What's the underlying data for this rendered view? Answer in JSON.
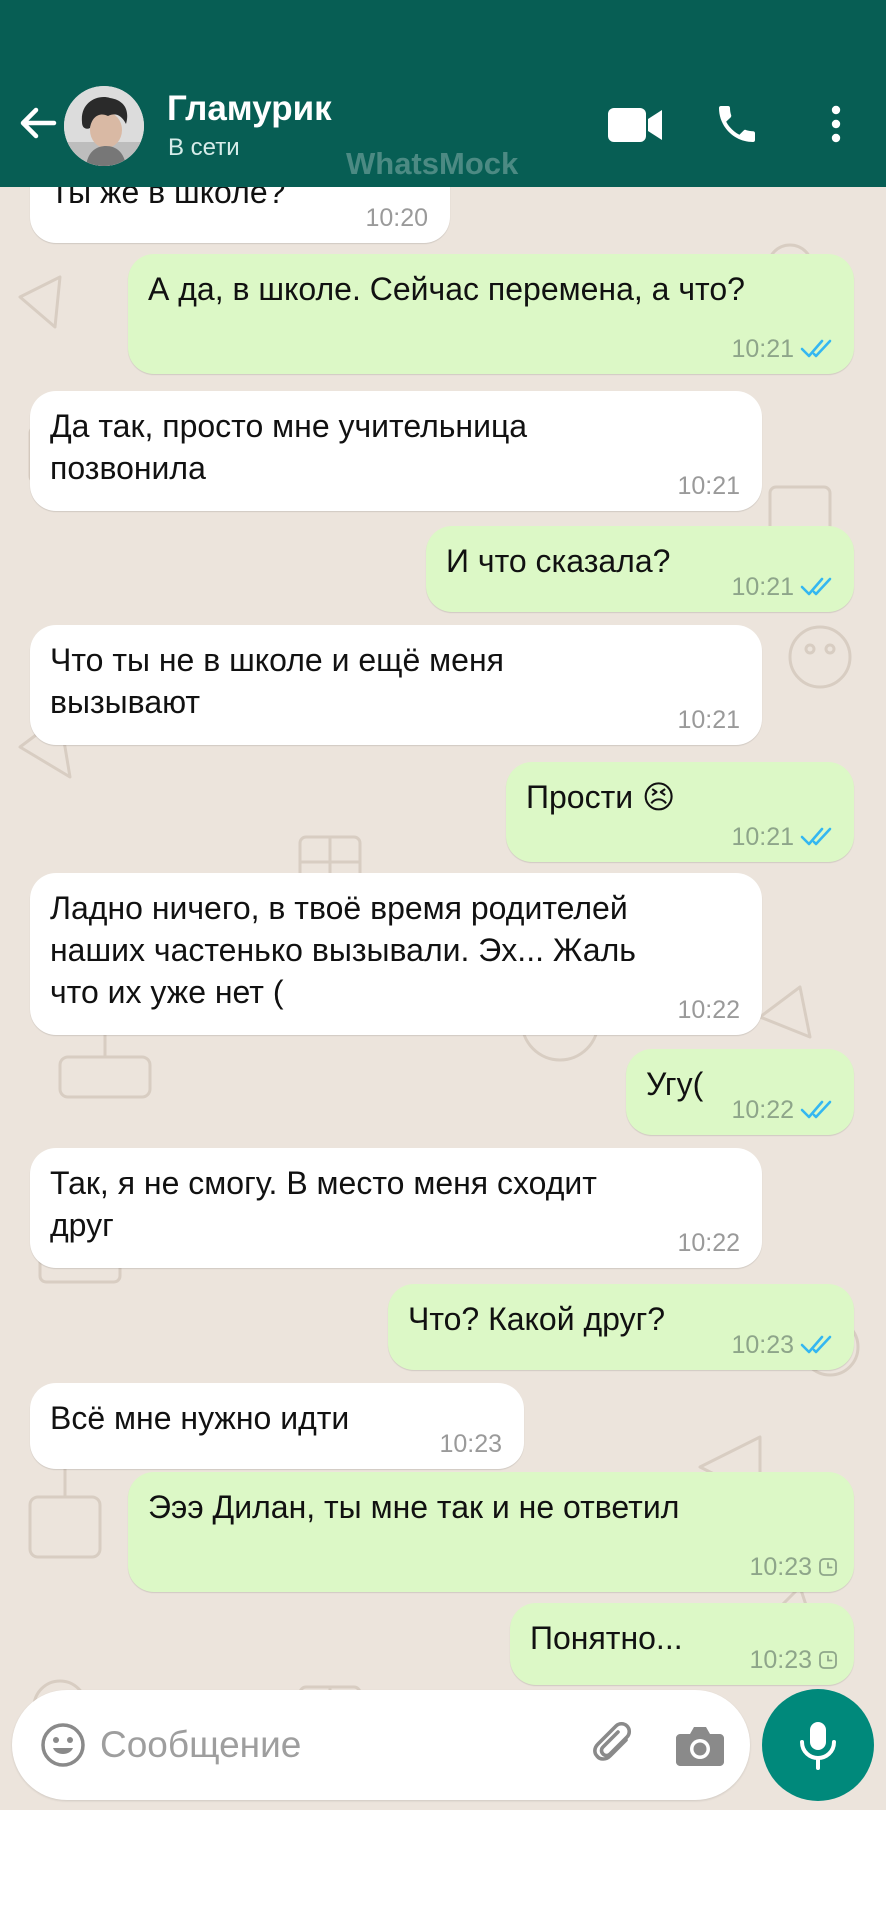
{
  "header": {
    "contact_name": "Гламурик",
    "status": "В сети",
    "watermark": "WhatsMock",
    "icons": [
      "arrow-left-icon",
      "avatar",
      "video-camera-icon",
      "phone-icon",
      "more-vertical-icon"
    ]
  },
  "messages": [
    {
      "dir": "in",
      "lines": [
        "Ты же в школе?"
      ],
      "time": "10:20",
      "status": "none"
    },
    {
      "dir": "out",
      "lines": [
        "А да, в школе. Сейчас перемена, а что?"
      ],
      "time": "10:21",
      "status": "read"
    },
    {
      "dir": "in",
      "lines": [
        "Да так, просто мне учительница",
        "позвонила"
      ],
      "time": "10:21",
      "status": "none"
    },
    {
      "dir": "out",
      "lines": [
        "И что сказала?"
      ],
      "time": "10:21",
      "status": "read"
    },
    {
      "dir": "in",
      "lines": [
        "Что ты не в школе и ещё меня",
        "вызывают"
      ],
      "time": "10:21",
      "status": "none"
    },
    {
      "dir": "out",
      "lines": [
        "Прости 😣"
      ],
      "time": "10:21",
      "status": "read"
    },
    {
      "dir": "in",
      "lines": [
        "Ладно ничего, в твоё время родителей",
        "наших частенько вызывали. Эх... Жаль",
        "что их уже нет ("
      ],
      "time": "10:22",
      "status": "none"
    },
    {
      "dir": "out",
      "lines": [
        "Угу("
      ],
      "time": "10:22",
      "status": "read"
    },
    {
      "dir": "in",
      "lines": [
        "Так, я не смогу. В место меня сходит",
        "друг"
      ],
      "time": "10:22",
      "status": "none"
    },
    {
      "dir": "out",
      "lines": [
        "Что? Какой друг?"
      ],
      "time": "10:23",
      "status": "read"
    },
    {
      "dir": "in",
      "lines": [
        "Всё мне нужно идти"
      ],
      "time": "10:23",
      "status": "none"
    },
    {
      "dir": "out",
      "lines": [
        "Эээ Дилан, ты мне так и не ответил"
      ],
      "time": "10:23",
      "status": "pending"
    },
    {
      "dir": "out",
      "lines": [
        "Понятно..."
      ],
      "time": "10:23",
      "status": "pending"
    }
  ],
  "input": {
    "placeholder": "Сообщение",
    "value": ""
  },
  "colors": {
    "header": "#075e54",
    "outgoing_bubble": "#dcf8c6",
    "incoming_bubble": "#ffffff",
    "chat_background": "#ece4dc",
    "read_tick": "#34b7f1",
    "mic_button": "#00897b"
  }
}
